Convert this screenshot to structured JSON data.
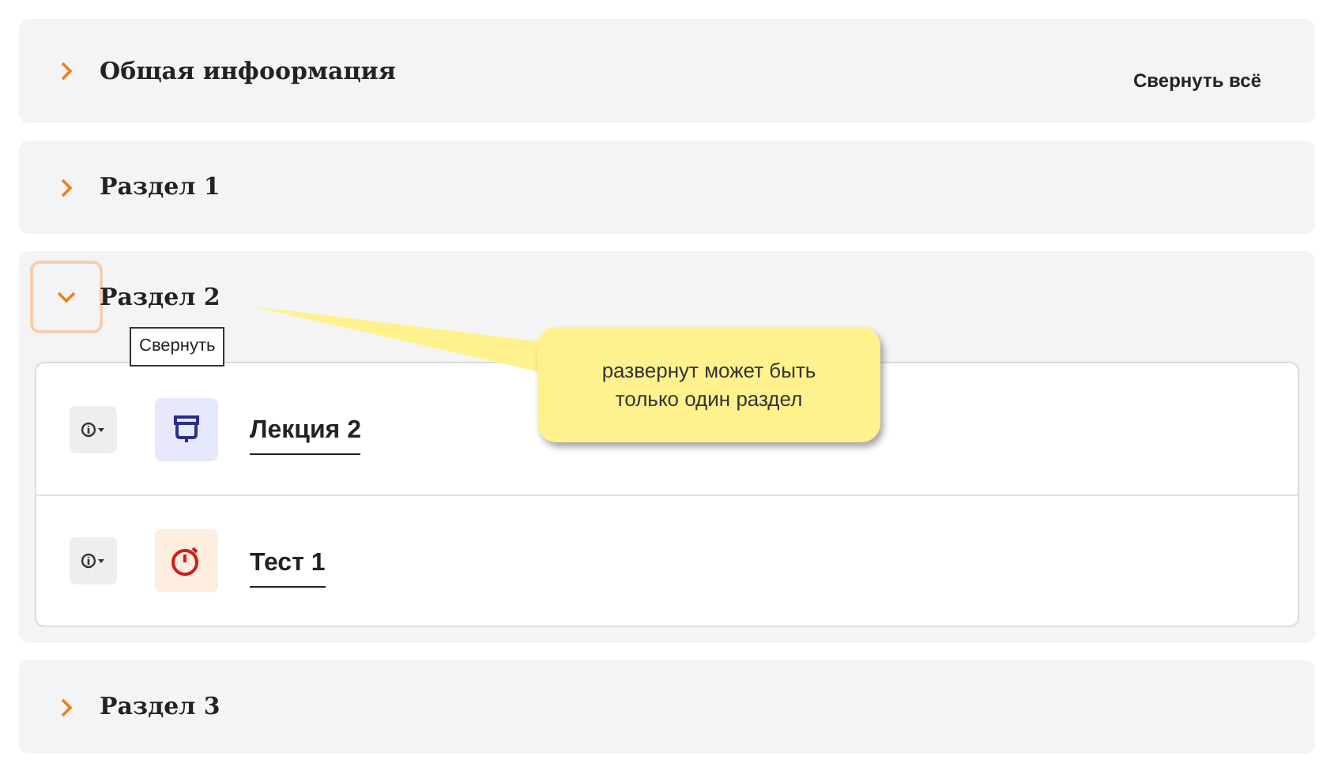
{
  "collapse_all_button": "Свернуть всё",
  "sections": [
    {
      "title": "Общая инфоормация",
      "expanded": false
    },
    {
      "title": "Раздел 1",
      "expanded": false
    },
    {
      "title": "Раздел 2",
      "expanded": true,
      "activities": [
        {
          "kind": "lecture",
          "title": "Лекция 2"
        },
        {
          "kind": "test",
          "title": "Тест 1"
        }
      ]
    },
    {
      "title": "Раздел 3",
      "expanded": false
    }
  ],
  "tooltip": "Свернуть",
  "callout": "развернут может быть только один раздел"
}
